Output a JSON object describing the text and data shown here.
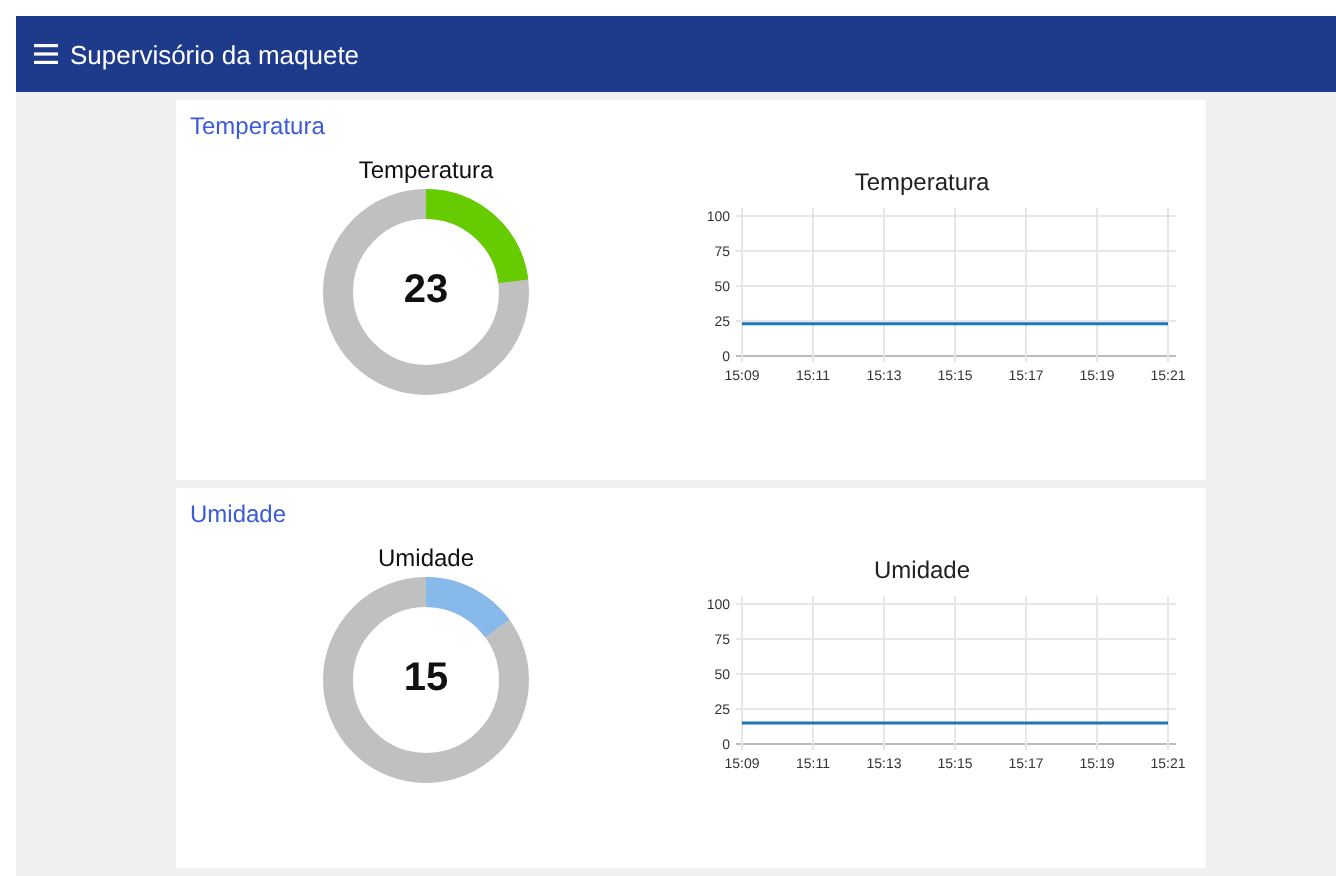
{
  "app_bar": {
    "title": "Supervisório da maquete"
  },
  "groups": [
    {
      "title": "Temperatura",
      "gauge": {
        "label": "Temperatura",
        "value": "23",
        "level": 0.23,
        "color": "#66cc00"
      },
      "chart_data": {
        "type": "line",
        "title": "Temperatura",
        "grid": true,
        "categories": [
          "15:09",
          "15:11",
          "15:13",
          "15:15",
          "15:17",
          "15:19",
          "15:21"
        ],
        "series": [
          {
            "color": "#1f77b4",
            "values": [
              23,
              23,
              23,
              23,
              23,
              23,
              23
            ]
          }
        ],
        "ylim": [
          0,
          100
        ],
        "yticks": [
          0,
          25,
          50,
          75,
          100
        ]
      }
    },
    {
      "title": "Umidade",
      "gauge": {
        "label": "Umidade",
        "value": "15",
        "level": 0.15,
        "color": "#87b9ea"
      },
      "chart_data": {
        "type": "line",
        "title": "Umidade",
        "grid": true,
        "categories": [
          "15:09",
          "15:11",
          "15:13",
          "15:15",
          "15:17",
          "15:19",
          "15:21"
        ],
        "series": [
          {
            "color": "#1f77b4",
            "values": [
              15,
              15,
              15,
              15,
              15,
              15,
              15
            ]
          }
        ],
        "ylim": [
          0,
          100
        ],
        "yticks": [
          0,
          25,
          50,
          75,
          100
        ]
      }
    }
  ]
}
